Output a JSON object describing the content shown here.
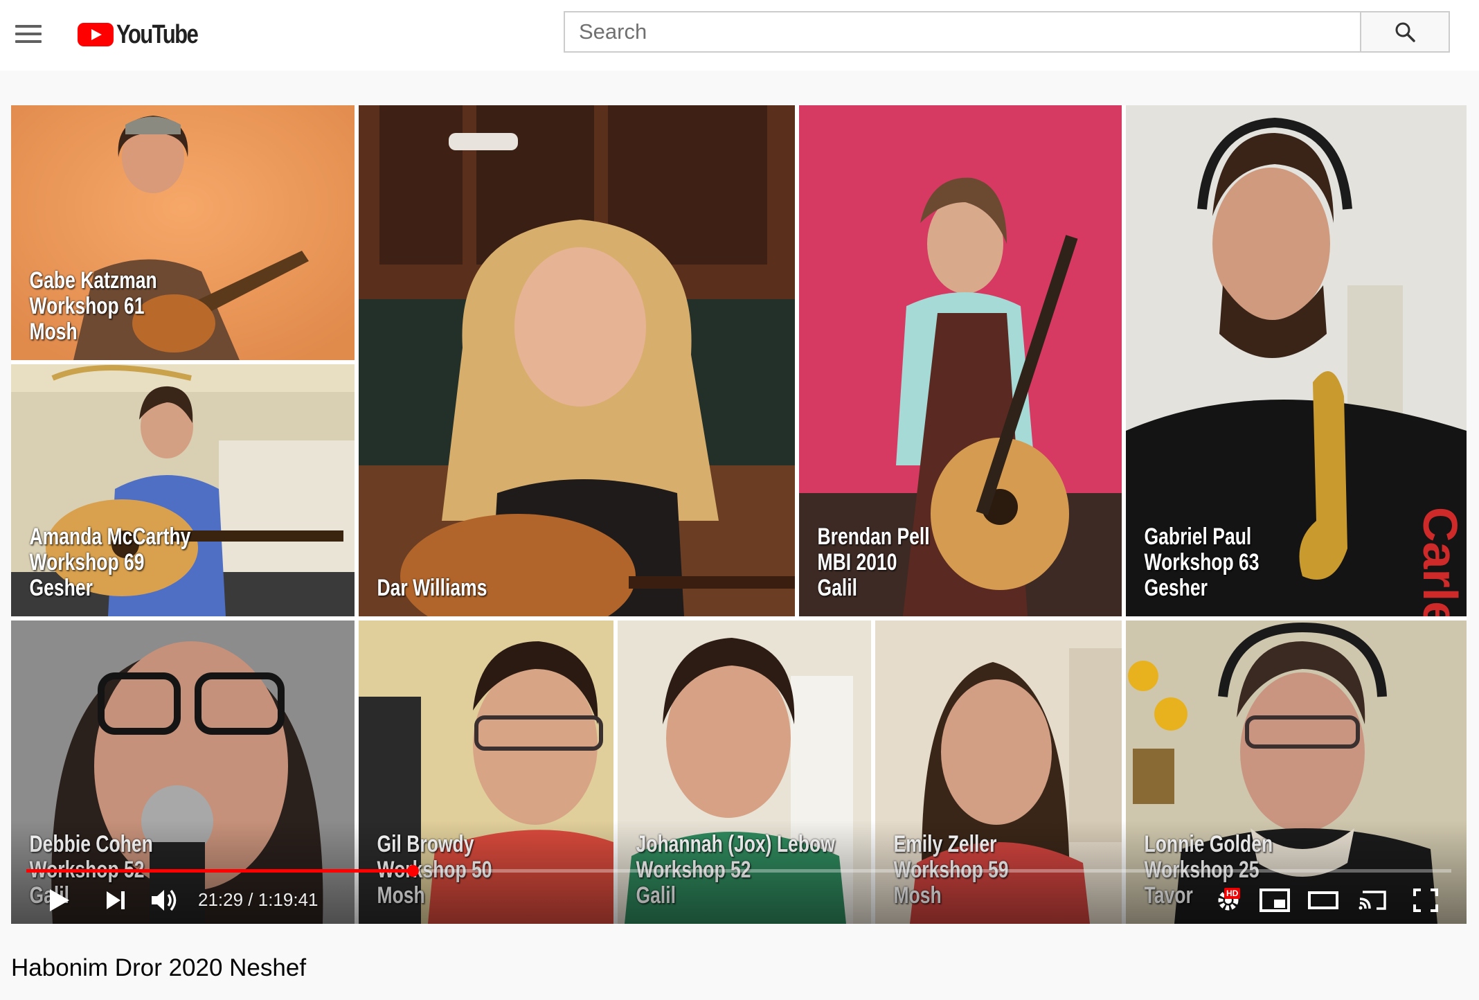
{
  "header": {
    "logo_text": "YouTube",
    "search_placeholder": "Search"
  },
  "video": {
    "tiles": [
      {
        "name": "Gabe Katzman",
        "line2": "Workshop 61",
        "line3": "Mosh"
      },
      {
        "name": "Amanda McCarthy",
        "line2": "Workshop 69",
        "line3": "Gesher"
      },
      {
        "name": "Dar Williams",
        "line2": "",
        "line3": ""
      },
      {
        "name": "Brendan Pell",
        "line2": "MBI 2010",
        "line3": "Galil"
      },
      {
        "name": "Gabriel Paul",
        "line2": "Workshop 63",
        "line3": "Gesher"
      },
      {
        "name": "Debbie Cohen",
        "line2": "Workshop 52",
        "line3": "Galil"
      },
      {
        "name": "Gil Browdy",
        "line2": "Workshop 50",
        "line3": "Mosh"
      },
      {
        "name": "Johannah (Jox) Lebow",
        "line2": "Workshop 52",
        "line3": "Galil"
      },
      {
        "name": "Emily Zeller",
        "line2": "Workshop 59",
        "line3": "Mosh"
      },
      {
        "name": "Lonnie Golden",
        "line2": "Workshop 25",
        "line3": "Tavor"
      }
    ],
    "shirt_text": "Carle",
    "controls": {
      "time": "21:29 / 1:19:41",
      "progress_fraction": 0.271,
      "hd_badge": "HD"
    },
    "title": "Habonim Dror 2020 Neshef"
  },
  "colors": {
    "youtube_red": "#ff0000",
    "progress_red": "#ff0000"
  },
  "icons": [
    "menu-icon",
    "youtube-logo-icon",
    "search-icon",
    "play-icon",
    "next-icon",
    "volume-icon",
    "settings-icon",
    "miniplayer-icon",
    "theater-icon",
    "cast-icon",
    "fullscreen-icon"
  ]
}
